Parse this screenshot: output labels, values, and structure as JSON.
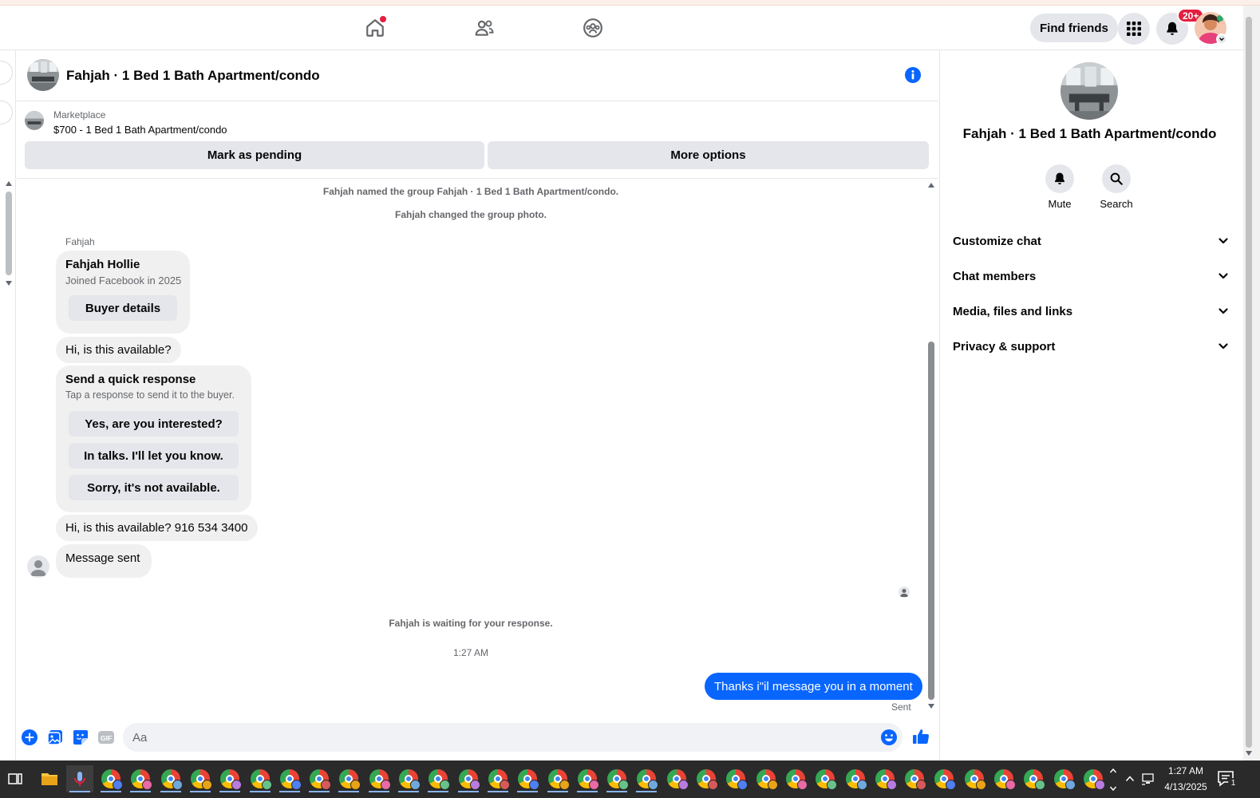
{
  "topbar": {
    "nav_icons": [
      "home-icon",
      "friends-icon",
      "groups-icon"
    ],
    "find_friends_label": "Find friends",
    "notification_badge": "20+"
  },
  "conversation": {
    "title": "Fahjah · 1 Bed 1 Bath Apartment/condo"
  },
  "marketplace": {
    "label": "Marketplace",
    "listing": "$700 - 1 Bed 1 Bath Apartment/condo",
    "mark_pending_label": "Mark as pending",
    "more_options_label": "More options"
  },
  "messages": {
    "system_named": "Fahjah named the group Fahjah · 1 Bed 1 Bath Apartment/condo.",
    "system_photo": "Fahjah changed the group photo.",
    "sender_name": "Fahjah",
    "buyer_card": {
      "name": "Fahjah Hollie",
      "joined": "Joined Facebook in 2025",
      "button": "Buyer details"
    },
    "msg1": "Hi, is this available?",
    "quick_response": {
      "title": "Send a quick response",
      "subtitle": "Tap a response to send it to the buyer.",
      "options": [
        "Yes, are you interested?",
        "In talks. I'll let you know.",
        "Sorry, it's not available."
      ]
    },
    "msg2": "Hi, is this available? 916 534 3400",
    "msg3": "Message sent",
    "waiting": "Fahjah is waiting for your response.",
    "timestamp": "1:27 AM",
    "outgoing": "Thanks i\"il message you in a moment",
    "status": "Sent"
  },
  "composer": {
    "placeholder": "Aa",
    "icons": [
      "plus-icon",
      "photo-icon",
      "sticker-icon",
      "gif-icon",
      "emoji-icon",
      "thumbs-up-icon"
    ]
  },
  "right_panel": {
    "title": "Fahjah · 1 Bed 1 Bath Apartment/condo",
    "mute_label": "Mute",
    "search_label": "Search",
    "sections": [
      "Customize chat",
      "Chat members",
      "Media, files and links",
      "Privacy & support"
    ]
  },
  "taskbar": {
    "time": "1:27 AM",
    "date": "4/13/2025",
    "notification_count": "1"
  },
  "colors": {
    "accent": "#0866ff",
    "badge": "#e41e3f",
    "bubble_gray": "#f0f0f0",
    "button_gray": "#e4e6eb",
    "taskbar": "#2a2a2a"
  }
}
